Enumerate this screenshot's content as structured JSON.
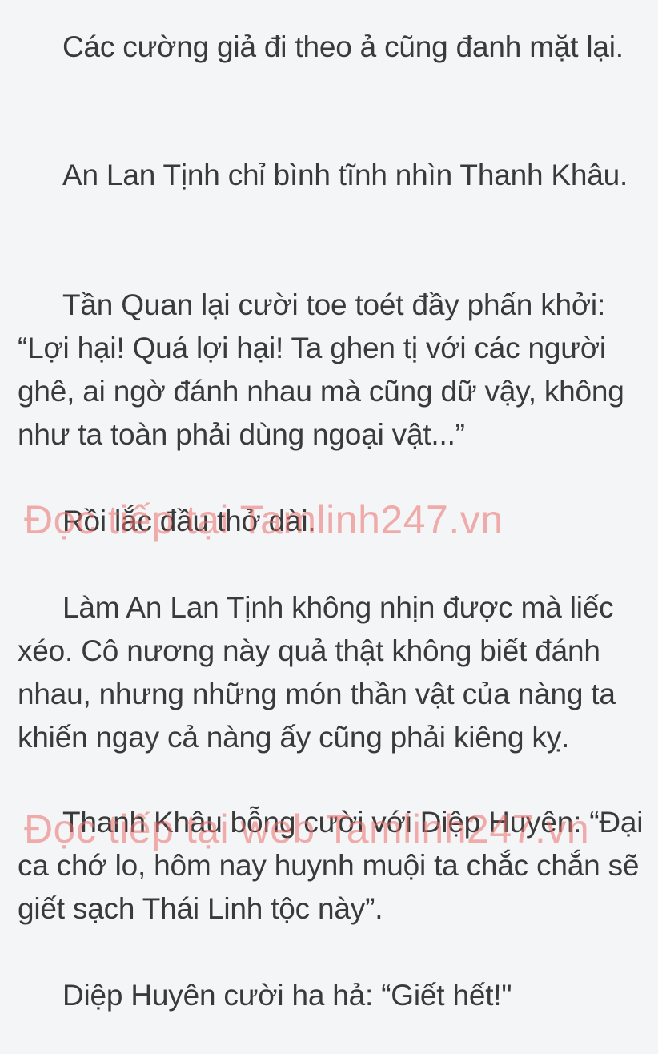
{
  "paragraphs": [
    "Các cường giả đi theo ả cũng đanh mặt lại.",
    "An Lan Tịnh chỉ bình tĩnh nhìn Thanh Khâu.",
    "Tần Quan lại cười toe toét đầy phấn khởi: “Lợi hại! Quá lợi hại! Ta ghen tị với các người ghê, ai ngờ đánh nhau mà cũng dữ vậy, không như ta toàn phải dùng ngoại vật...”",
    "Rồi lắc đầu thở dài.",
    "Làm An Lan Tịnh không nhịn được mà liếc xéo. Cô nương này quả thật không biết đánh nhau, nhưng những món thần vật của nàng ta khiến ngay cả nàng ấy cũng phải kiêng kỵ.",
    "Thanh Khâu bỗng cười với Diệp Huyên: “Đại ca chớ lo, hôm nay huynh muội ta chắc chắn sẽ giết sạch Thái Linh tộc này”.",
    "Diệp Huyên cười ha hả: “Giết hết!\""
  ],
  "watermarks": [
    "Đọc tiếp tại Tamlinh247.vn",
    "Đọc tiếp tại web Tamlinh247.vn"
  ],
  "colors": {
    "background": "#f4f5f7",
    "text": "#3a3a3a",
    "watermark": "#eb6e69"
  }
}
